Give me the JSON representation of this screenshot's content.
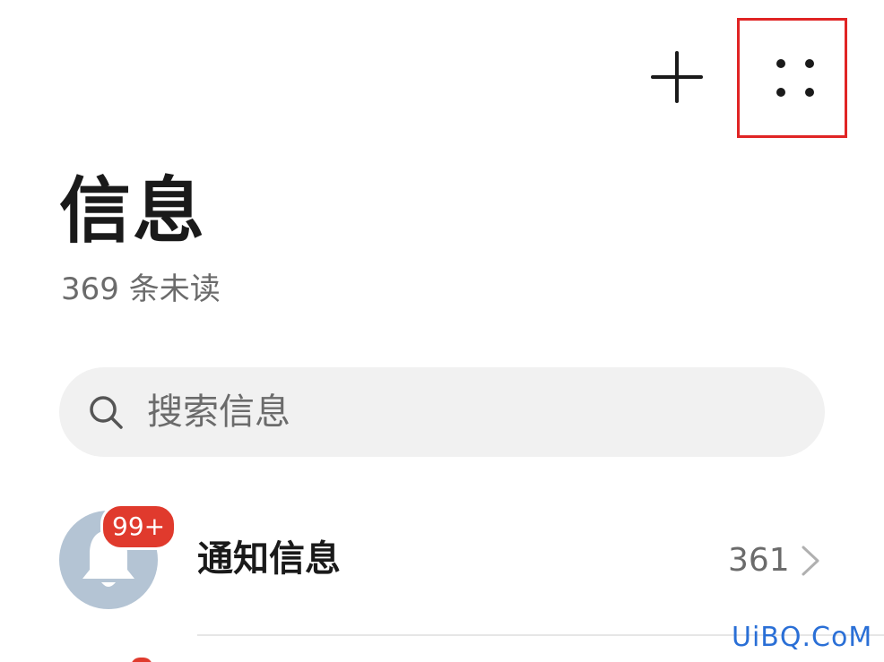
{
  "header": {
    "add_icon": "plus-icon",
    "more_icon": "four-dots-icon",
    "highlight_color": "#e02424"
  },
  "page": {
    "title": "信息",
    "unread": "369 条未读"
  },
  "search": {
    "placeholder": "搜索信息",
    "icon": "search-icon"
  },
  "conversations": [
    {
      "title": "通知信息",
      "count": "361",
      "badge": "99+",
      "badge_color": "#e03a2d",
      "avatar_icon": "bell-icon"
    }
  ],
  "watermark": "UiBQ.CoM"
}
